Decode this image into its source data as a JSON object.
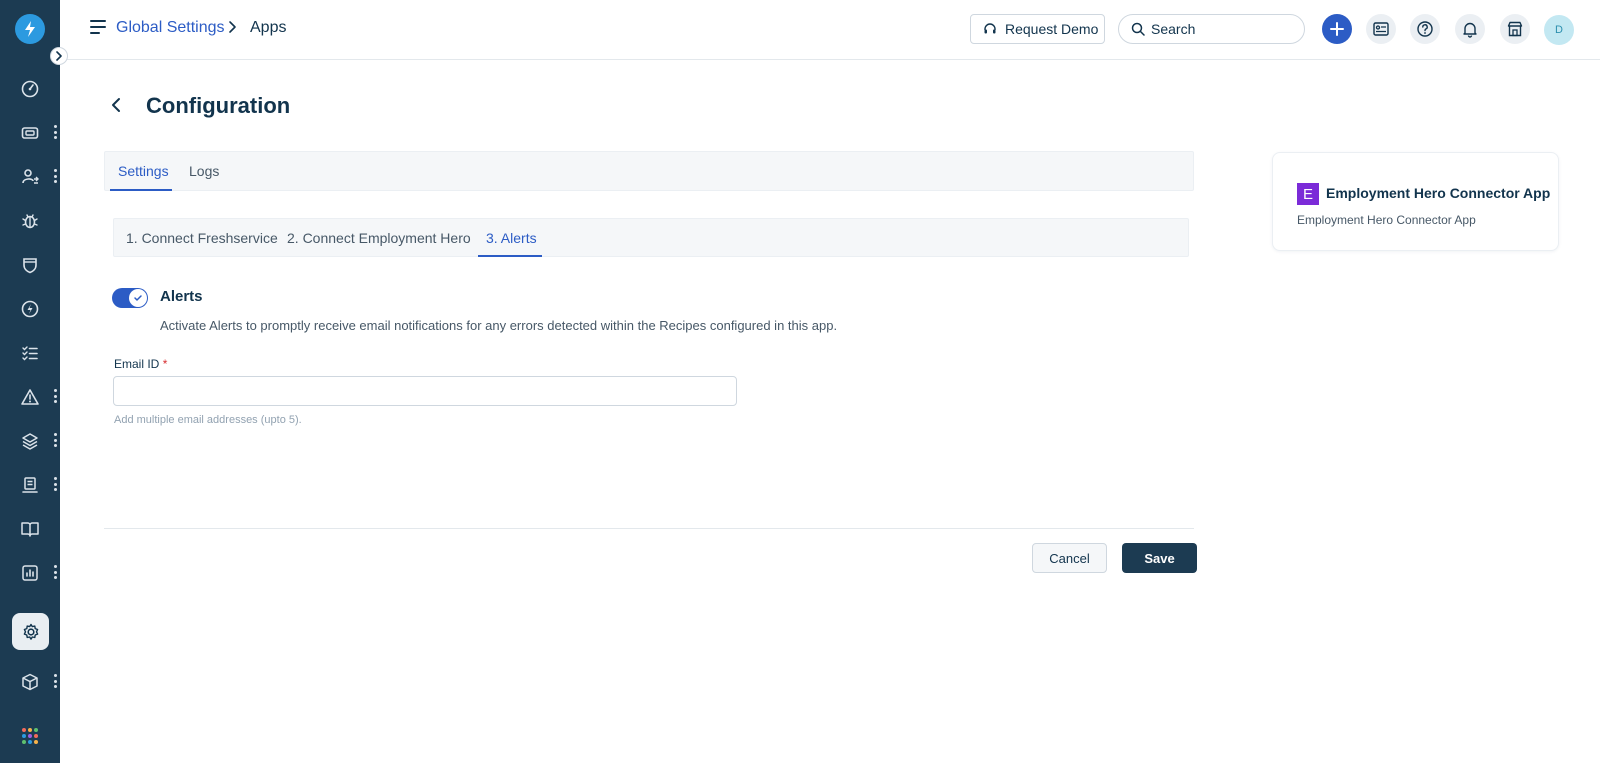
{
  "header": {
    "breadcrumb_link": "Global Settings",
    "breadcrumb_current": "Apps",
    "request_demo_label": "Request Demo",
    "search_placeholder": "Search",
    "avatar_initial": "D"
  },
  "sidebar": {
    "items": [
      {
        "icon": "dashboard-icon"
      },
      {
        "icon": "tickets-icon",
        "has_menu": true
      },
      {
        "icon": "user-switch-icon",
        "has_menu": true
      },
      {
        "icon": "bug-icon"
      },
      {
        "icon": "shield-icon"
      },
      {
        "icon": "lightning-icon"
      },
      {
        "icon": "checklist-icon"
      },
      {
        "icon": "alert-icon",
        "has_menu": true
      },
      {
        "icon": "layers-icon",
        "has_menu": true
      },
      {
        "icon": "reports-icon",
        "has_menu": true
      },
      {
        "icon": "book-icon"
      },
      {
        "icon": "analytics-icon",
        "has_menu": true
      },
      {
        "icon": "settings-icon",
        "active": true
      },
      {
        "icon": "cube-icon",
        "has_menu": true
      }
    ]
  },
  "page": {
    "title": "Configuration",
    "tabs": [
      {
        "label": "Settings",
        "active": true
      },
      {
        "label": "Logs",
        "active": false
      }
    ],
    "steps": [
      {
        "label": "1. Connect Freshservice",
        "active": false
      },
      {
        "label": "2. Connect Employment Hero",
        "active": false
      },
      {
        "label": "3. Alerts",
        "active": true
      }
    ],
    "alerts": {
      "enabled": true,
      "title": "Alerts",
      "description": "Activate Alerts to promptly receive email notifications for any errors detected within the Recipes configured in this app."
    },
    "email": {
      "label": "Email ID",
      "required_mark": "*",
      "value": "",
      "hint": "Add multiple email addresses (upto 5)."
    },
    "actions": {
      "cancel_label": "Cancel",
      "save_label": "Save"
    }
  },
  "app_card": {
    "logo_letter": "E",
    "name": "Employment Hero Connector App",
    "subtitle": "Employment Hero Connector App"
  },
  "colors": {
    "sidebar_bg": "#1c3b52",
    "accent": "#2c5cc5",
    "app_logo": "#7b2bd8"
  }
}
